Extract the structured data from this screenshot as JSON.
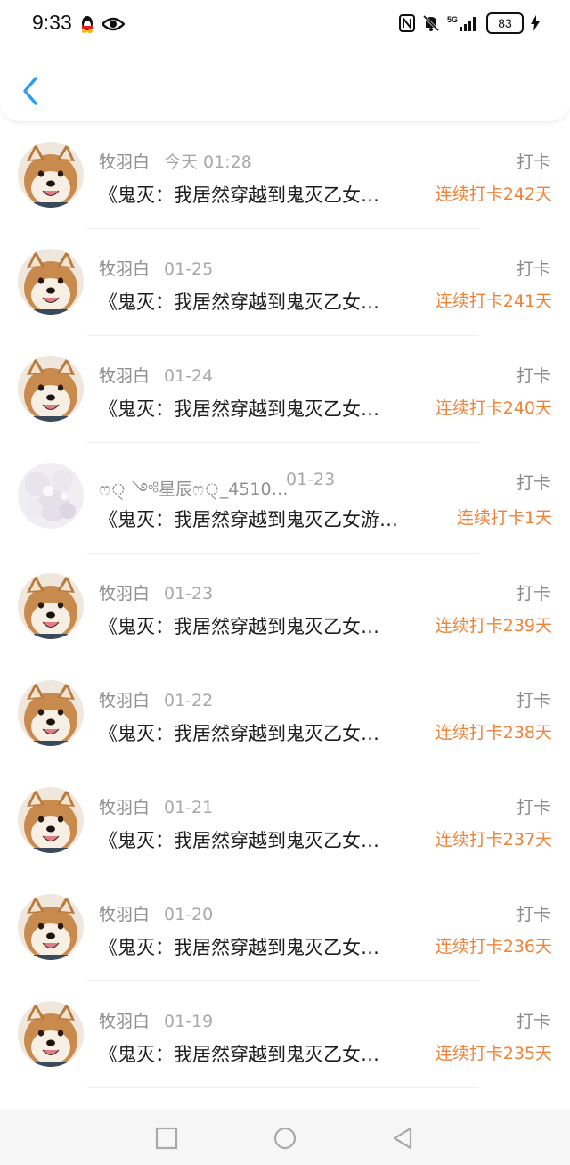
{
  "status_bar": {
    "time": "9:33",
    "left_icons": [
      "qq-penguin-icon",
      "eye-icon"
    ],
    "right_icons": [
      "nfc-icon",
      "mute-bell-icon",
      "signal-5g-icon"
    ],
    "network": "5G",
    "battery": "83"
  },
  "header": {
    "back_icon": "chevron-left-icon",
    "accent_color": "#2f9df4"
  },
  "colors": {
    "streak": "#f0833a",
    "meta": "#8f8f8f"
  },
  "items": [
    {
      "name": "牧羽白",
      "date": "今天 01:28",
      "kind": "打卡",
      "title": "《鬼灭：我居然穿越到鬼灭乙女…",
      "streak": "连续打卡242天"
    },
    {
      "name": "牧羽白",
      "date": "01-25",
      "kind": "打卡",
      "title": "《鬼灭：我居然穿越到鬼灭乙女…",
      "streak": "连续打卡241天"
    },
    {
      "name": "牧羽白",
      "date": "01-24",
      "kind": "打卡",
      "title": "《鬼灭：我居然穿越到鬼灭乙女…",
      "streak": "连续打卡240天"
    },
    {
      "name": "ෆ্ ༺星辰ෆ্_4510…",
      "date": "01-23",
      "kind": "打卡",
      "title": "《鬼灭：我居然穿越到鬼灭乙女游…",
      "streak": "连续打卡1天"
    },
    {
      "name": "牧羽白",
      "date": "01-23",
      "kind": "打卡",
      "title": "《鬼灭：我居然穿越到鬼灭乙女…",
      "streak": "连续打卡239天"
    },
    {
      "name": "牧羽白",
      "date": "01-22",
      "kind": "打卡",
      "title": "《鬼灭：我居然穿越到鬼灭乙女…",
      "streak": "连续打卡238天"
    },
    {
      "name": "牧羽白",
      "date": "01-21",
      "kind": "打卡",
      "title": "《鬼灭：我居然穿越到鬼灭乙女…",
      "streak": "连续打卡237天"
    },
    {
      "name": "牧羽白",
      "date": "01-20",
      "kind": "打卡",
      "title": "《鬼灭：我居然穿越到鬼灭乙女…",
      "streak": "连续打卡236天"
    },
    {
      "name": "牧羽白",
      "date": "01-19",
      "kind": "打卡",
      "title": "《鬼灭：我居然穿越到鬼灭乙女…",
      "streak": "连续打卡235天"
    }
  ],
  "nav_bar": {
    "buttons": [
      "recent-apps-icon",
      "home-icon",
      "back-triangle-icon"
    ]
  }
}
